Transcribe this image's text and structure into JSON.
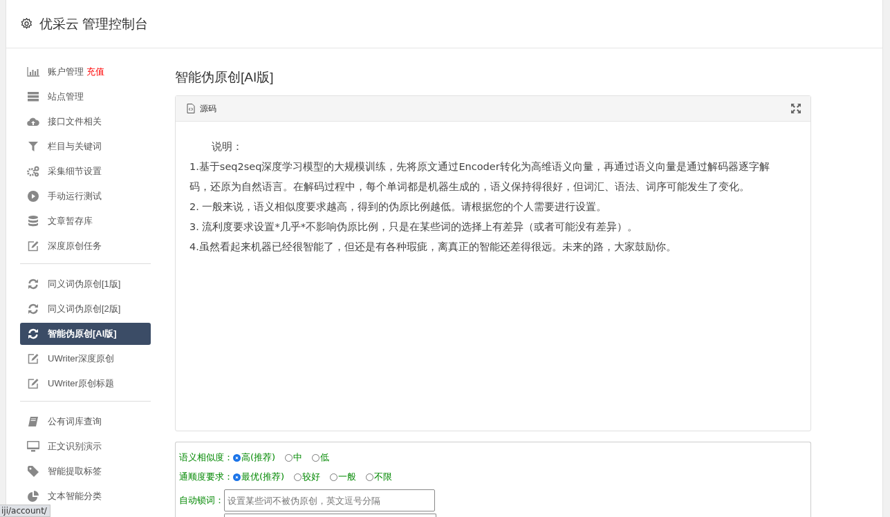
{
  "header": {
    "title": "优采云 管理控制台"
  },
  "sidebar": {
    "groups": [
      {
        "items": [
          {
            "label": "账户管理",
            "badge": "充值",
            "kind": "chart",
            "selected": false
          },
          {
            "label": "站点管理",
            "kind": "server",
            "selected": false
          },
          {
            "label": "接口文件相关",
            "kind": "cloud",
            "selected": false
          },
          {
            "label": "栏目与关键词",
            "kind": "filter",
            "selected": false
          },
          {
            "label": "采集细节设置",
            "kind": "gears",
            "selected": false
          },
          {
            "label": "手动运行测试",
            "kind": "play",
            "selected": false
          },
          {
            "label": "文章暂存库",
            "kind": "database",
            "selected": false
          },
          {
            "label": "深度原创任务",
            "kind": "edit",
            "selected": false
          }
        ]
      },
      {
        "items": [
          {
            "label": "同义词伪原创[1版]",
            "kind": "refresh",
            "selected": false
          },
          {
            "label": "同义词伪原创[2版]",
            "kind": "refresh",
            "selected": false
          },
          {
            "label": "智能伪原创[AI版]",
            "kind": "refresh",
            "selected": true
          },
          {
            "label": "UWriter深度原创",
            "kind": "edit",
            "selected": false
          },
          {
            "label": "UWriter原创标题",
            "kind": "edit",
            "selected": false
          }
        ]
      },
      {
        "items": [
          {
            "label": "公有词库查询",
            "kind": "book",
            "selected": false
          },
          {
            "label": "正文识别演示",
            "kind": "monitor",
            "selected": false
          },
          {
            "label": "智能提取标签",
            "kind": "tag",
            "selected": false
          },
          {
            "label": "文本智能分类",
            "kind": "pie",
            "selected": false
          }
        ]
      }
    ]
  },
  "page_title": "智能伪原创[AI版]",
  "editor": {
    "tab": "源码",
    "paragraphs": [
      "说明：",
      "1.基于seq2seq深度学习模型的大规模训练，先将原文通过Encoder转化为高维语义向量，再通过语义向量是通过解码器逐字解码，还原为自然语言。在解码过程中，每个单词都是机器生成的，语义保持得很好，但词汇、语法、词序可能发生了变化。",
      "2. 一般来说，语义相似度要求越高，得到的伪原比例越低。请根据您的个人需要进行设置。",
      "3. 流利度要求设置*几乎*不影响伪原比例，只是在某些词的选择上有差异（或者可能没有差异）。",
      "4.虽然看起来机器已经很智能了，但还是有各种瑕疵，离真正的智能还差得很远。未来的路，大家鼓励你。"
    ]
  },
  "options": {
    "similarity": {
      "label": "语义相似度：",
      "choices": [
        {
          "label": "高(推荐)",
          "selected": true
        },
        {
          "label": "中",
          "selected": false
        },
        {
          "label": "低",
          "selected": false
        }
      ]
    },
    "fluency": {
      "label": "通顺度要求：",
      "choices": [
        {
          "label": "最优(推荐)",
          "selected": true
        },
        {
          "label": "较好",
          "selected": false
        },
        {
          "label": "一般",
          "selected": false
        },
        {
          "label": "不限",
          "selected": false
        }
      ]
    },
    "lock_words": {
      "label": "自动锁词：",
      "placeholder": "设置某些词不被伪原创，英文逗号分隔"
    }
  },
  "status_url": "iji/account/"
}
